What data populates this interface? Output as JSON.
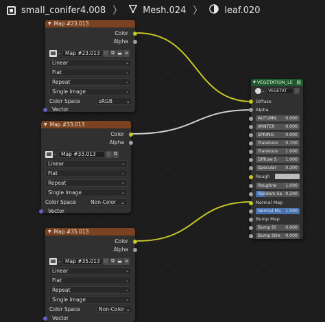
{
  "breadcrumb": {
    "object": "small_conifer4.008",
    "mesh": "Mesh.024",
    "material": "leaf.020",
    "separator": "〉"
  },
  "image_nodes": [
    {
      "title": "Map #23.013",
      "out_color": "Color",
      "out_alpha": "Alpha",
      "image_name": "Map #23.013",
      "interpolation": "Linear",
      "projection": "Flat",
      "extension": "Repeat",
      "source": "Single Image",
      "color_space_label": "Color Space",
      "color_space": "sRGB",
      "in_vector": "Vector"
    },
    {
      "title": "Map #33.013",
      "out_color": "Color",
      "out_alpha": "Alpha",
      "image_name": "Map #33.013",
      "interpolation": "Linear",
      "projection": "Flat",
      "extension": "Repeat",
      "source": "Single Image",
      "color_space_label": "Color Space",
      "color_space": "Non-Color",
      "in_vector": "Vector"
    },
    {
      "title": "Map #35.013",
      "out_color": "Color",
      "out_alpha": "Alpha",
      "image_name": "Map #35.013",
      "interpolation": "Linear",
      "projection": "Flat",
      "extension": "Repeat",
      "source": "Single Image",
      "color_space_label": "Color Space",
      "color_space": "Non-Color",
      "in_vector": "Vector"
    }
  ],
  "group_node": {
    "title": "VEGETATION_LE",
    "group_name": "VEGETAT",
    "inputs": {
      "diffuse": "Diffuse",
      "alpha": "Alpha",
      "roughness": "Rough",
      "normal_map": "Normal Map",
      "bump_map": "Bump Map"
    },
    "fields": [
      {
        "label": "AUTUMN",
        "value": "0.000"
      },
      {
        "label": "WINTER",
        "value": "0.000"
      },
      {
        "label": "SPRING",
        "value": "0.000"
      },
      {
        "label": "Transluce",
        "value": "0.700"
      },
      {
        "label": "Transluce",
        "value": "1.000"
      },
      {
        "label": "Diffuse S",
        "value": "1.000"
      },
      {
        "label": "Specular",
        "value": "0.300"
      }
    ],
    "roughness_field": {
      "label": "Roughne",
      "value": "1.000"
    },
    "random_field": {
      "label": "Random Sa",
      "value": "0.200"
    },
    "normal_field": {
      "label": "Normal Ma",
      "value": "1.000"
    },
    "bump_fields": [
      {
        "label": "Bump Di",
        "value": "0.000"
      },
      {
        "label": "Bump Stre",
        "value": "0.000"
      }
    ]
  },
  "colors": {
    "image_header": "#7a4220",
    "group_header": "#1c5a2c",
    "color_socket": "#c7c729",
    "grey_socket": "#a1a1a1",
    "vector_socket": "#6363c7",
    "slider_fill": "#4772b3"
  }
}
